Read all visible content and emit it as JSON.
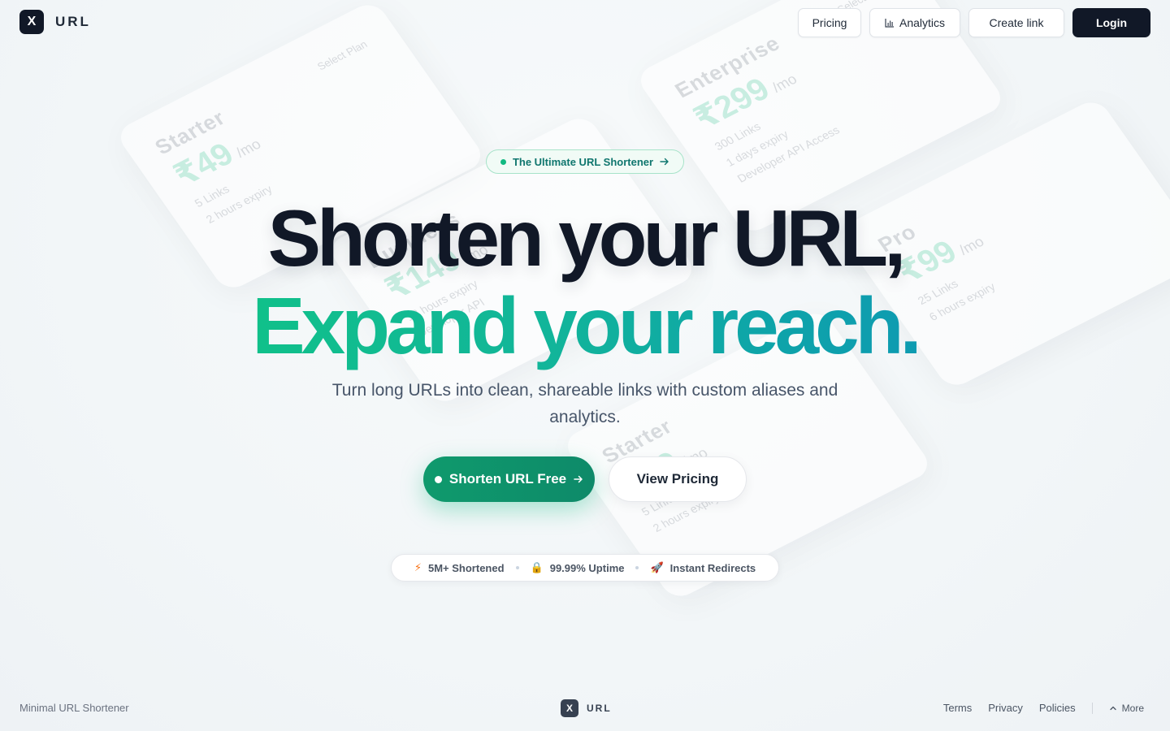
{
  "brand": {
    "mark": "X",
    "name": "URL"
  },
  "nav": {
    "pricing": "Pricing",
    "analytics": "Analytics",
    "create_link": "Create link",
    "login": "Login"
  },
  "background_cards": [
    {
      "name": "Starter",
      "price": "₹49",
      "per": "/mo",
      "features": [
        "5 Links",
        "2 hours expiry"
      ],
      "select": "Select Plan"
    },
    {
      "name": "Enterprise",
      "price": "₹299",
      "per": "/mo",
      "features": [
        "300 Links",
        "1 days expiry",
        "Developer API Access"
      ],
      "select": "Select Plan"
    },
    {
      "name": "Business",
      "price": "₹149",
      "per": "/mo",
      "features": [
        "12 hours expiry",
        "Developer API"
      ],
      "select": ""
    },
    {
      "name": "Pro",
      "price": "₹99",
      "per": "/mo",
      "features": [
        "25 Links",
        "6 hours expiry"
      ],
      "select": ""
    },
    {
      "name": "Starter",
      "price": "₹49",
      "per": "/mo",
      "features": [
        "5 Links",
        "2 hours expiry"
      ],
      "select": ""
    }
  ],
  "hero": {
    "badge": "The Ultimate URL Shortener",
    "headline_line1": "Shorten your URL,",
    "headline_line2": "Expand your reach.",
    "subtitle": "Turn long URLs into clean, shareable links with custom aliases and analytics.",
    "cta_primary": "Shorten URL Free",
    "cta_secondary": "View Pricing"
  },
  "stats": [
    {
      "icon": "⚡",
      "label": "5M+ Shortened"
    },
    {
      "icon": "🔒",
      "label": "99.99% Uptime"
    },
    {
      "icon": "🚀",
      "label": "Instant Redirects"
    }
  ],
  "footer": {
    "tagline": "Minimal URL Shortener",
    "links": [
      "Terms",
      "Privacy",
      "Policies"
    ],
    "more": "More"
  },
  "colors": {
    "accent": "#10b981",
    "dark": "#111827",
    "teal": "#0e9bb1"
  }
}
